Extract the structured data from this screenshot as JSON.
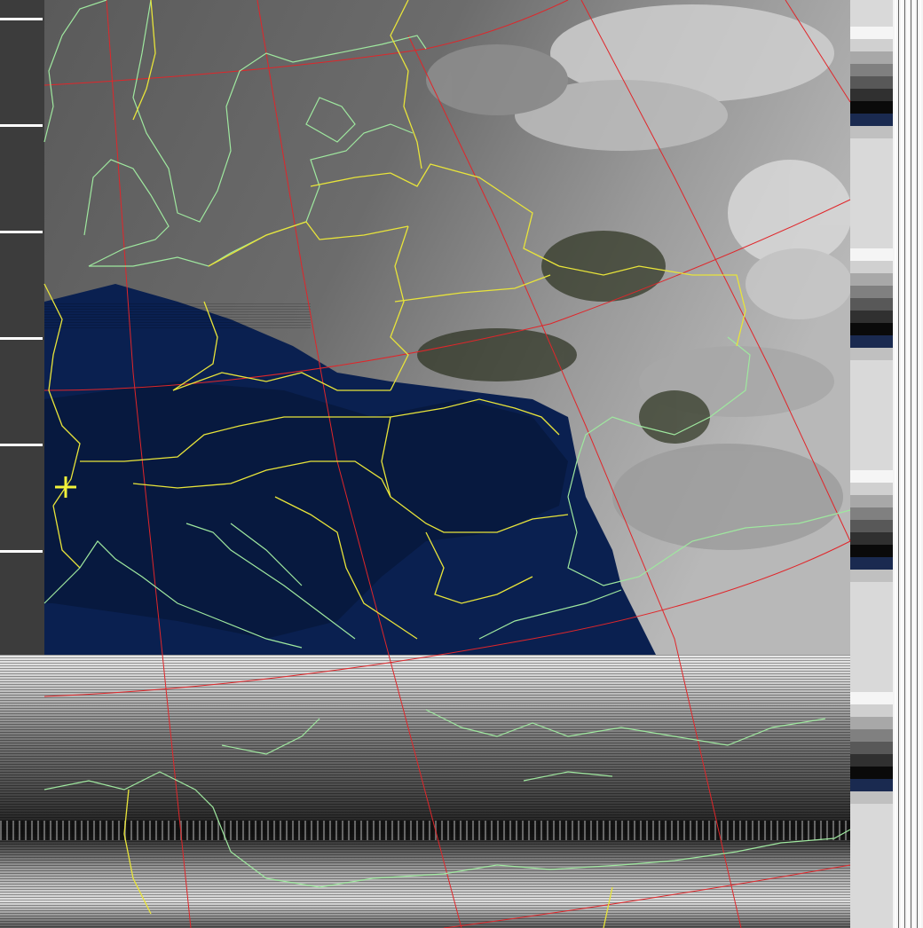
{
  "image": {
    "kind": "NOAA APT satellite weather image with map overlay",
    "colors": {
      "sea_night": "#0b2150",
      "land_night": "#071a3e",
      "cloud_gray": "#8a8a8a",
      "cloud_bright": "#e6e6e6",
      "grid_lines": "#e0262a",
      "borders": "#e8e43a",
      "coastlines": "#9fe89f",
      "marker": "#f2f23a",
      "telemetry_strip": "#3a3a3a"
    },
    "overlays": [
      "latitude-longitude-grid",
      "country-borders",
      "coastlines",
      "location-marker"
    ],
    "telemetry_wedges": 9
  }
}
